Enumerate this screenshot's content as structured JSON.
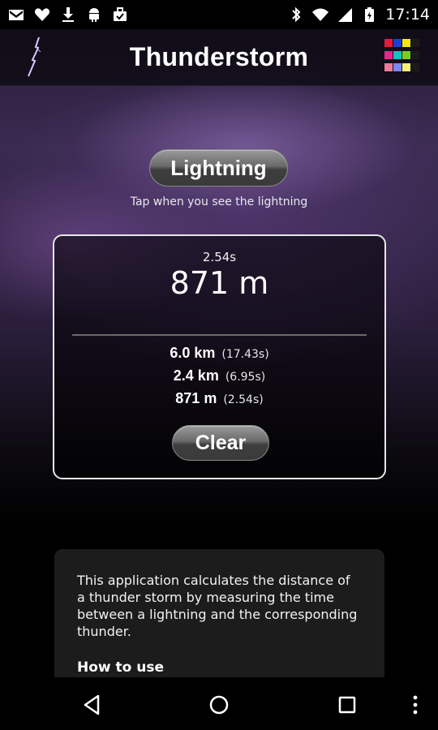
{
  "status_bar": {
    "time": "17:14",
    "left_icons": [
      "gmail-icon",
      "heart-icon",
      "download-icon",
      "android-icon",
      "briefcase-icon"
    ],
    "right_icons": [
      "bluetooth-icon",
      "wifi-icon",
      "signal-icon",
      "battery-charging-icon"
    ]
  },
  "app_bar": {
    "title": "Thunderstorm",
    "logo": "lightning-logo-icon",
    "menu_icon": "color-palette-icon",
    "palette_colors": [
      "#e8193a",
      "#1d3fd6",
      "#f2e611",
      "#1a1a1a",
      "#e9238e",
      "#13c2c2",
      "#7ccc1e",
      "#1a1a1a",
      "#f07a9a",
      "#7a8af0",
      "#f7f07a",
      "#1a1a1a"
    ]
  },
  "main": {
    "lightning_button_label": "Lightning",
    "hint": "Tap when you see the lightning",
    "current": {
      "time": "2.54s",
      "distance": "871 m"
    },
    "history": [
      {
        "distance": "6.0 km",
        "time": "(17.43s)"
      },
      {
        "distance": "2.4 km",
        "time": "(6.95s)"
      },
      {
        "distance": "871 m",
        "time": "(2.54s)"
      }
    ],
    "clear_button_label": "Clear"
  },
  "info": {
    "description": "This application calculates the distance of a thunder storm by measuring the time between a lightning and the corresponding thunder.",
    "heading": "How to use"
  },
  "nav_bar": {
    "icons": [
      "back-icon",
      "home-icon",
      "recents-icon",
      "overflow-menu-icon"
    ]
  }
}
